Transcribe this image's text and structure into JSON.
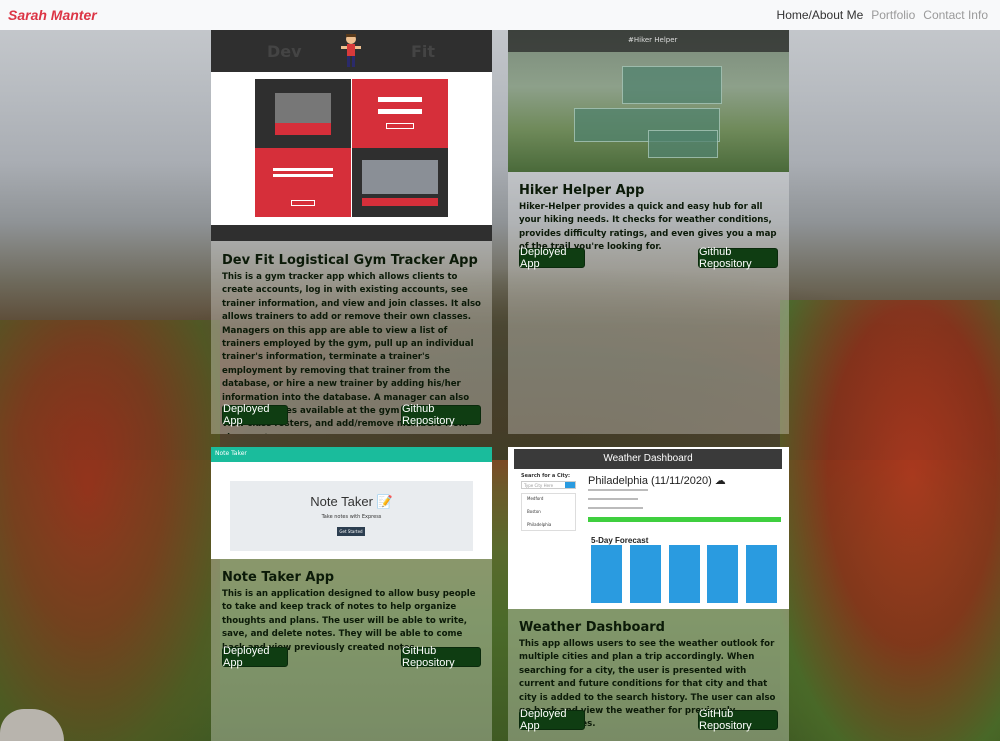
{
  "navbar": {
    "brand": "Sarah Manter",
    "links": [
      "Home/About Me",
      "Portfolio",
      "Contact Info"
    ]
  },
  "colors": {
    "brand": "#dc3545",
    "button": "#0f3d12",
    "note_bar": "#1abc9c",
    "weather_day": "#2a9be0"
  },
  "projects": [
    {
      "title": "Dev Fit Logistical Gym Tracker App",
      "description": "This is a gym tracker app which allows clients to create accounts, log in with existing accounts, see trainer information, and view and join classes. It also allows trainers to add or remove their own classes. Managers on this app are able to view a list of trainers employed by the gym, pull up an individual trainer's information, terminate a trainer's employment by removing that trainer from the database, or hire a new trainer by adding his/her information into the database. A manager can also view all classes available at the gym for the week, view class rosters, and add/remove members from class rosters..",
      "deployed_label": "Deployed App",
      "repo_label": "Github Repository",
      "screenshot": {
        "word_left": "Dev",
        "word_right": "Fit"
      }
    },
    {
      "title": "Hiker Helper App",
      "description": "Hiker-Helper provides a quick and easy hub for all your hiking needs. It checks for weather conditions, provides difficulty ratings, and even gives you a map of the trail you're looking for.",
      "deployed_label": "Deployed App",
      "repo_label": "Github Repository",
      "screenshot": {
        "bar_title": "#Hiker Helper"
      }
    },
    {
      "title": "Note Taker App",
      "description": "This is an application designed to allow busy people to take and keep track of notes to help organize thoughts and plans. The user will be able to write, save, and delete notes. They will be able to come back and view previously created notes.",
      "deployed_label": "Deployed App",
      "repo_label": "GitHub Repository",
      "screenshot": {
        "bar_title": "Note Taker",
        "heading": "Note Taker 📝",
        "sub": "Take notes with Express",
        "button": "Get Started"
      }
    },
    {
      "title": "Weather Dashboard",
      "description": "This app allows users to see the weather outlook for multiple cities and plan a trip accordingly. When searching for a city, the user is presented with current and future conditions for that city and that city is added to the search history. The user can also go back and view the weather for previously searched cities.",
      "deployed_label": "Deployed App",
      "repo_label": "GitHub Repository",
      "screenshot": {
        "header": "Weather Dashboard",
        "search_label": "Search for a City:",
        "search_placeholder": "Type City Here",
        "history": [
          "Medford",
          "Boston",
          "Philadelphia"
        ],
        "city": "Philadelphia (11/11/2020) ☁",
        "forecast_title": "5-Day Forecast"
      }
    }
  ]
}
